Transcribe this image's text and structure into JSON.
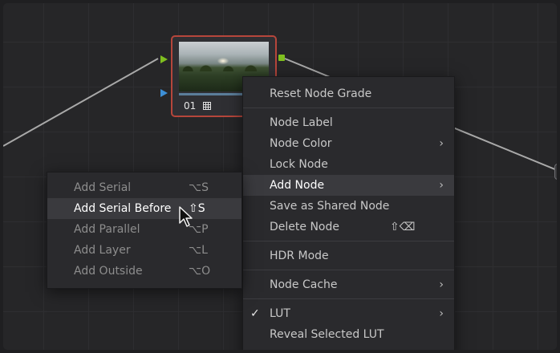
{
  "node": {
    "number": "01",
    "icons": [
      "thumbnail-image-icon",
      "grid-icon",
      "input-port-green-icon",
      "input-port-blue-icon",
      "output-port-green-icon"
    ]
  },
  "context_menu": {
    "items": [
      {
        "label": "Reset Node Grade"
      },
      {
        "label": "Node Label"
      },
      {
        "label": "Node Color",
        "arrow": "›"
      },
      {
        "label": "Lock Node"
      },
      {
        "label": "Add Node",
        "arrow": "›",
        "highlighted": true
      },
      {
        "label": "Save as Shared Node"
      },
      {
        "label": "Delete Node",
        "shortcut": "⇧⌫"
      },
      {
        "label": "HDR Mode"
      },
      {
        "label": "Node Cache",
        "arrow": "›"
      },
      {
        "label": "LUT",
        "arrow": "›",
        "checked": true,
        "check": "✓"
      },
      {
        "label": "Reveal Selected LUT"
      }
    ]
  },
  "add_node_submenu": {
    "items": [
      {
        "label": "Add Serial",
        "shortcut": "⌥S"
      },
      {
        "label": "Add Serial Before",
        "shortcut": "⇧S",
        "highlighted": true
      },
      {
        "label": "Add Parallel",
        "shortcut": "⌥P"
      },
      {
        "label": "Add Layer",
        "shortcut": "⌥L"
      },
      {
        "label": "Add Outside",
        "shortcut": "⌥O"
      }
    ]
  },
  "colors": {
    "background": "#262628",
    "node_border": "#b6463b",
    "port_green": "#7fbf1f",
    "port_blue": "#3d8fd6",
    "menu_bg": "#2a2a2d",
    "highlight": "#3a3a3e"
  }
}
